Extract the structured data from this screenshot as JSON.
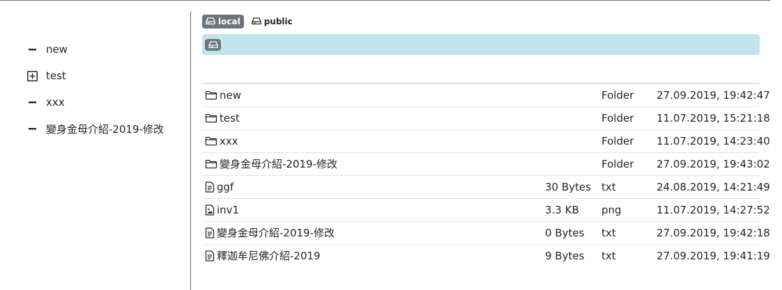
{
  "sidebar": {
    "items": [
      {
        "label": "new",
        "toggle": "minus-icon"
      },
      {
        "label": "test",
        "toggle": "plus-square-icon"
      },
      {
        "label": "xxx",
        "toggle": "minus-icon"
      },
      {
        "label": "變身金母介紹-2019-修改",
        "toggle": "minus-icon"
      }
    ]
  },
  "disks": [
    {
      "label": "local",
      "active": true,
      "icon": "hdd-icon"
    },
    {
      "label": "public",
      "active": false,
      "icon": "hdd-icon"
    }
  ],
  "breadcrumb": {
    "root_icon": "hdd-icon"
  },
  "colors": {
    "breadcrumb_bg": "#c2e5ec",
    "active_disk_bg": "#6c757d"
  },
  "files": [
    {
      "name": "new",
      "size": "",
      "type": "Folder",
      "date": "27.09.2019, 19:42:47",
      "icon": "folder-icon"
    },
    {
      "name": "test",
      "size": "",
      "type": "Folder",
      "date": "11.07.2019, 15:21:18",
      "icon": "folder-icon"
    },
    {
      "name": "xxx",
      "size": "",
      "type": "Folder",
      "date": "11.07.2019, 14:23:40",
      "icon": "folder-icon"
    },
    {
      "name": "變身金母介紹-2019-修改",
      "size": "",
      "type": "Folder",
      "date": "27.09.2019, 19:43:02",
      "icon": "folder-icon"
    },
    {
      "name": "ggf",
      "size": "30 Bytes",
      "type": "txt",
      "date": "24.08.2019, 14:21:49",
      "icon": "file-text-icon"
    },
    {
      "name": "inv1",
      "size": "3.3 KB",
      "type": "png",
      "date": "11.07.2019, 14:27:52",
      "icon": "file-image-icon"
    },
    {
      "name": "變身金母介紹-2019-修改",
      "size": "0 Bytes",
      "type": "txt",
      "date": "27.09.2019, 19:42:18",
      "icon": "file-text-icon"
    },
    {
      "name": "釋迦牟尼佛介紹-2019",
      "size": "9 Bytes",
      "type": "txt",
      "date": "27.09.2019, 19:41:19",
      "icon": "file-text-icon"
    }
  ]
}
